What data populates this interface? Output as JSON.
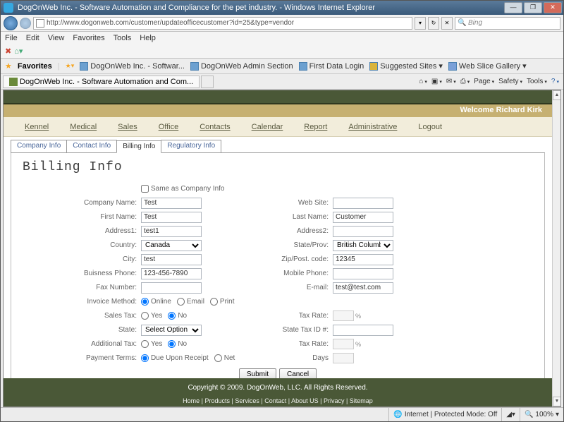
{
  "window": {
    "title": "DogOnWeb Inc. - Software Automation and Compliance for the pet industry. - Windows Internet Explorer",
    "url": "http://www.dogonweb.com/customer/updateofficecustomer?id=25&type=vendor",
    "search_placeholder": "Bing"
  },
  "menubar": [
    "File",
    "Edit",
    "View",
    "Favorites",
    "Tools",
    "Help"
  ],
  "favbar": {
    "label": "Favorites",
    "items": [
      "DogOnWeb Inc. - Softwar...",
      "DogOnWeb Admin Section",
      "First Data Login",
      "Suggested Sites",
      "Web Slice Gallery"
    ]
  },
  "browser_tab": "DogOnWeb Inc. - Software Automation and Com...",
  "cmdbar": {
    "page": "Page",
    "safety": "Safety",
    "tools": "Tools"
  },
  "welcome": "Welcome Richard Kirk",
  "sitenav": [
    "Kennel",
    "Medical",
    "Sales",
    "Office",
    "Contacts",
    "Calendar",
    "Report",
    "Administrative",
    "Logout"
  ],
  "subtabs": [
    "Company Info",
    "Contact Info",
    "Billing Info",
    "Regulatory Info"
  ],
  "panel_title": "Billing Info",
  "form": {
    "same_as": "Same as Company Info",
    "labels": {
      "company": "Company Name:",
      "website": "Web Site:",
      "first": "First Name:",
      "last": "Last Name:",
      "addr1": "Address1:",
      "addr2": "Address2:",
      "country": "Country:",
      "state_prov": "State/Prov:",
      "city": "City:",
      "zip": "Zip/Post. code:",
      "bphone": "Buisness Phone:",
      "mphone": "Mobile Phone:",
      "fax": "Fax Number:",
      "email": "E-mail:",
      "invoice": "Invoice Method:",
      "salestax": "Sales Tax:",
      "taxrate": "Tax Rate:",
      "state": "State:",
      "stateid": "State Tax ID #:",
      "addtax": "Additional Tax:",
      "taxrate2": "Tax Rate:",
      "payterms": "Payment Terms:",
      "days": "Days"
    },
    "values": {
      "company": "Test",
      "website": "",
      "first": "Test",
      "last": "Customer",
      "addr1": "test1",
      "addr2": "",
      "country": "Canada",
      "state_prov": "British Columbia",
      "city": "test",
      "zip": "12345",
      "bphone": "123-456-7890",
      "mphone": "",
      "fax": "",
      "email": "test@test.com",
      "state_sel": "Select Option"
    },
    "radios": {
      "invoice": [
        "Online",
        "Email",
        "Print"
      ],
      "yesno": [
        "Yes",
        "No"
      ],
      "payterms": [
        "Due Upon Receipt",
        "Net"
      ]
    },
    "buttons": {
      "submit": "Submit",
      "cancel": "Cancel"
    },
    "pct": "%"
  },
  "footer": {
    "copy": "Copyright © 2009.   DogOnWeb, LLC.   All Rights Reserved.",
    "links": "Home | Products | Services | Contact | About US | Privacy | Sitemap"
  },
  "statusbar": {
    "zone": "Internet | Protected Mode: Off",
    "zoom": "100%"
  }
}
